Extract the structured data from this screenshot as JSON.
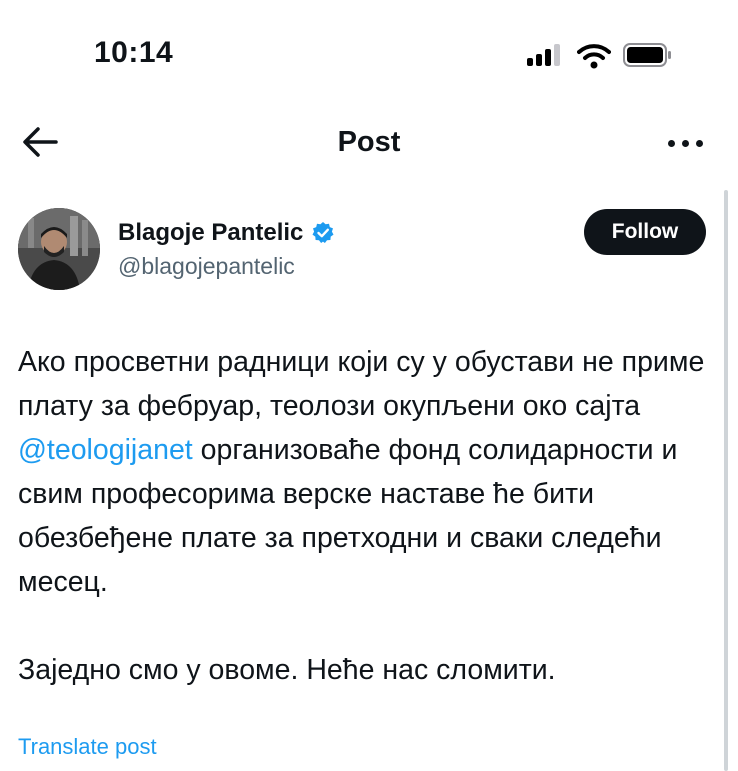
{
  "status_bar": {
    "time": "10:14"
  },
  "nav": {
    "title": "Post"
  },
  "author": {
    "name": "Blagoje Pantelic",
    "handle": "@blagojepantelic",
    "verified": true
  },
  "follow_button": {
    "label": "Follow"
  },
  "post": {
    "paragraph1": {
      "before_mention": "Ако просветни радници који су у обустави не приме плату за фебруар, теолози окупљени око сајта ",
      "mention": "@teologijanet",
      "after_mention": " организоваће фонд солидарности и свим професорима верске наставе ће бити обезбеђене плате за претходни и сваки следећи месец."
    },
    "paragraph2": "Заједно смо у овоме. Неће нас сломити."
  },
  "translate_link": "Translate post",
  "icons": {
    "signal": "cellular-signal-icon",
    "wifi": "wifi-icon",
    "battery": "battery-icon",
    "back": "back-arrow-icon",
    "more": "more-options-icon",
    "verified": "verified-badge-icon"
  },
  "colors": {
    "accent": "#1d9bf0",
    "text": "#0f1419",
    "secondary_text": "#536471",
    "follow_bg": "#0f1419"
  }
}
